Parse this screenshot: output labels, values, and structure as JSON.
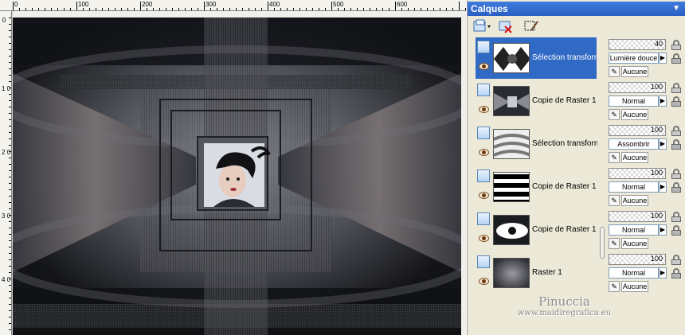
{
  "palette": {
    "title": "Calques",
    "pin_icon": "pin-icon"
  },
  "ruler": {
    "top_labels": [
      "0",
      "100",
      "200",
      "300",
      "400",
      "500",
      "600"
    ],
    "left_labels": [
      "0",
      "1 0 0",
      "2 0 0",
      "3 0 0",
      "4 0 0"
    ]
  },
  "layers": [
    {
      "name": "Sélection transformée",
      "selected": true,
      "opacity": "40",
      "blend": "Lumière douce",
      "mask": "Aucune"
    },
    {
      "name": "Copie de Raster 1",
      "selected": false,
      "opacity": "100",
      "blend": "Normal",
      "mask": "Aucune"
    },
    {
      "name": "Sélection transformée",
      "selected": false,
      "opacity": "100",
      "blend": "Assombrir",
      "mask": "Aucune"
    },
    {
      "name": "Copie de Raster 1",
      "selected": false,
      "opacity": "100",
      "blend": "Normal",
      "mask": "Aucune"
    },
    {
      "name": "Copie de Raster 1",
      "selected": false,
      "opacity": "100",
      "blend": "Normal",
      "mask": "Aucune"
    },
    {
      "name": "Raster 1",
      "selected": false,
      "opacity": "100",
      "blend": "Normal",
      "mask": "Aucune"
    }
  ],
  "watermark": {
    "name": "Pinuccia",
    "url": "www.maidiregrafica.eu"
  },
  "colors": {
    "selection": "#316ac5",
    "titlebar": "#2a5fc2",
    "panel": "#ece9d8"
  }
}
